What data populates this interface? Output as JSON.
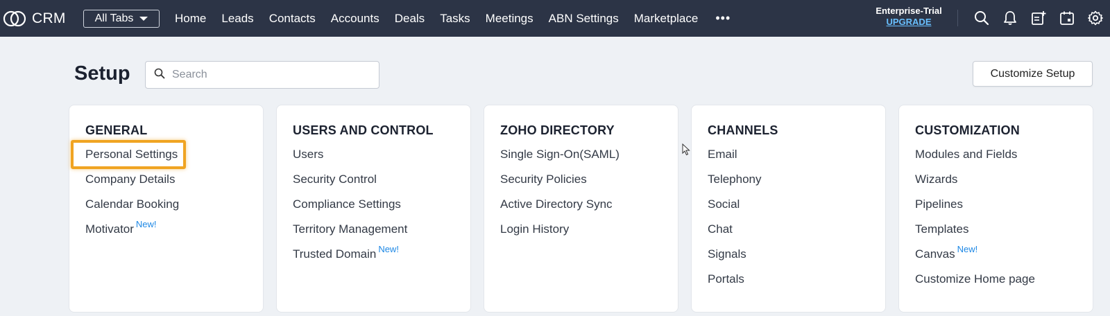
{
  "brand": {
    "name": "CRM",
    "logo_icon": "zoho-crm-logo-icon"
  },
  "nav": {
    "all_tabs_label": "All Tabs",
    "items": [
      "Home",
      "Leads",
      "Contacts",
      "Accounts",
      "Deals",
      "Tasks",
      "Meetings",
      "ABN Settings",
      "Marketplace"
    ],
    "more_label": "•••"
  },
  "trial": {
    "label": "Enterprise-Trial",
    "upgrade_label": "UPGRADE"
  },
  "header_icons": [
    "search-icon",
    "bell-icon",
    "add-note-icon",
    "calendar-icon",
    "gear-icon"
  ],
  "setup": {
    "title": "Setup",
    "search_placeholder": "Search",
    "customize_label": "Customize Setup"
  },
  "new_badge": "New!",
  "sections": [
    {
      "title": "GENERAL",
      "items": [
        {
          "label": "Personal Settings",
          "new": false
        },
        {
          "label": "Company Details",
          "new": false
        },
        {
          "label": "Calendar Booking",
          "new": false
        },
        {
          "label": "Motivator",
          "new": true
        }
      ]
    },
    {
      "title": "USERS AND CONTROL",
      "items": [
        {
          "label": "Users",
          "new": false
        },
        {
          "label": "Security Control",
          "new": false
        },
        {
          "label": "Compliance Settings",
          "new": false
        },
        {
          "label": "Territory Management",
          "new": false
        },
        {
          "label": "Trusted Domain",
          "new": true
        }
      ]
    },
    {
      "title": "ZOHO DIRECTORY",
      "items": [
        {
          "label": "Single Sign-On(SAML)",
          "new": false
        },
        {
          "label": "Security Policies",
          "new": false
        },
        {
          "label": "Active Directory Sync",
          "new": false
        },
        {
          "label": "Login History",
          "new": false
        }
      ]
    },
    {
      "title": "CHANNELS",
      "items": [
        {
          "label": "Email",
          "new": false
        },
        {
          "label": "Telephony",
          "new": false
        },
        {
          "label": "Social",
          "new": false
        },
        {
          "label": "Chat",
          "new": false
        },
        {
          "label": "Signals",
          "new": false
        },
        {
          "label": "Portals",
          "new": false
        }
      ]
    },
    {
      "title": "CUSTOMIZATION",
      "items": [
        {
          "label": "Modules and Fields",
          "new": false
        },
        {
          "label": "Wizards",
          "new": false
        },
        {
          "label": "Pipelines",
          "new": false
        },
        {
          "label": "Templates",
          "new": false
        },
        {
          "label": "Canvas",
          "new": true
        },
        {
          "label": "Customize Home page",
          "new": false
        }
      ]
    }
  ],
  "highlighted_item": "Personal Settings",
  "colors": {
    "topbar": "#2c3446",
    "highlight": "#f0a422",
    "new_badge": "#1e88e5",
    "upgrade_link": "#69c0ff"
  }
}
